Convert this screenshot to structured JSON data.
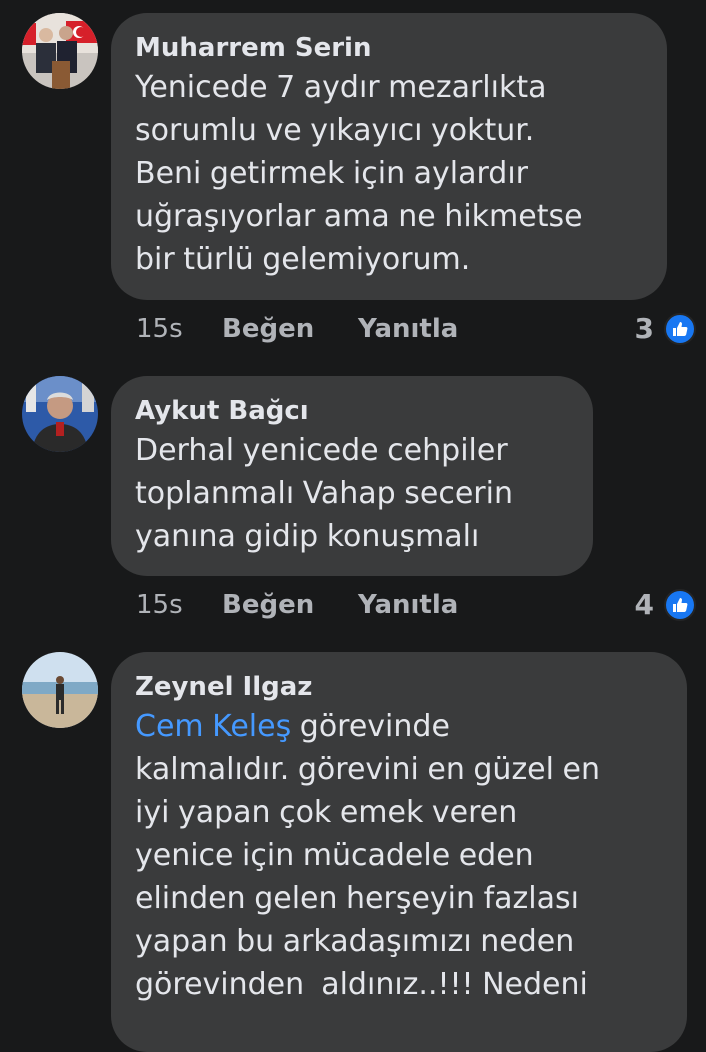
{
  "comments": [
    {
      "author": "Muharrem Serin",
      "avatar_icon": "profile-photo",
      "text_lines": [
        "Yenicede 7 aydır mezarlıkta",
        "sorumlu ve yıkayıcı yoktur.",
        "Beni getirmek için aylardır",
        "uğraşıyorlar ama ne hikmetse",
        "bir türlü gelemiyorum."
      ],
      "time": "15s",
      "like_label": "Beğen",
      "reply_label": "Yanıtla",
      "reaction_count": "3",
      "reaction_icon": "thumbs-up-icon"
    },
    {
      "author": "Aykut Bağcı",
      "avatar_icon": "profile-photo",
      "text_lines": [
        "Derhal yenicede cehpiler",
        "toplanmalı Vahap secerin",
        "yanına gidip konuşmalı"
      ],
      "time": "15s",
      "like_label": "Beğen",
      "reply_label": "Yanıtla",
      "reaction_count": "4",
      "reaction_icon": "thumbs-up-icon"
    },
    {
      "author": "Zeynel Ilgaz",
      "avatar_icon": "profile-photo",
      "mention": "Cem Keleş",
      "first_line_rest": " görevinde",
      "text_lines": [
        "kalmalıdır. görevini en güzel en",
        "iyi yapan çok emek veren",
        "yenice için mücadele eden",
        "elinden gelen herşeyin fazlası",
        "yapan bu arkadaşımızı neden",
        "görevinden  aldınız..!!! Nedeni"
      ]
    }
  ],
  "colors": {
    "background": "#18191a",
    "bubble": "#3a3b3c",
    "text": "#e4e6eb",
    "secondary_text": "#b0b3b8",
    "mention": "#4599ff",
    "like_badge": "#1877f2"
  }
}
